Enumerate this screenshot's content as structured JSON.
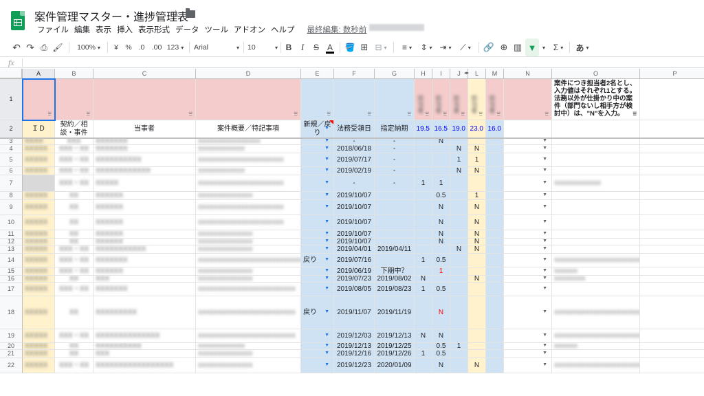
{
  "app": {
    "title": "案件管理マスター・進捗管理表",
    "last_edit": "最終編集: 数秒前",
    "menu": [
      "ファイル",
      "編集",
      "表示",
      "挿入",
      "表示形式",
      "データ",
      "ツール",
      "アドオン",
      "ヘルプ"
    ]
  },
  "toolbar": {
    "zoom": "100%",
    "currency": "¥",
    "percent": "%",
    "dec_less": ".0",
    "dec_more": ".00",
    "format_more": "123",
    "font": "Arial",
    "font_size": "10",
    "bold": "B",
    "italic": "I",
    "strike": "S",
    "text_color": "A",
    "sigma": "Σ",
    "input_tool": "あ"
  },
  "formula_bar": {
    "fx": "fx",
    "value": ""
  },
  "columns": [
    {
      "key": "A",
      "label": "A"
    },
    {
      "key": "B",
      "label": "B"
    },
    {
      "key": "C",
      "label": "C"
    },
    {
      "key": "D",
      "label": "D"
    },
    {
      "key": "E",
      "label": "E"
    },
    {
      "key": "F",
      "label": "F"
    },
    {
      "key": "G",
      "label": "G"
    },
    {
      "key": "H",
      "label": "H"
    },
    {
      "key": "I",
      "label": "I"
    },
    {
      "key": "J",
      "label": "J"
    },
    {
      "key": "L",
      "label": "L"
    },
    {
      "key": "M",
      "label": "M"
    },
    {
      "key": "N",
      "label": "N"
    },
    {
      "key": "O",
      "label": "O"
    },
    {
      "key": "P",
      "label": "P"
    }
  ],
  "header": {
    "row1_note": "案件につき担当者2名とし、入力値はそれぞれ1とする。法務以外が仕掛かり中の案件（部門ないし相手方が検討中）は、\"N\"を入力。",
    "row2": {
      "A": "ＩＤ",
      "B": "契約／相談・事件",
      "C": "当事者",
      "D": "案件概要／特記事項",
      "E": "新規／戻り",
      "F": "法務受領日",
      "G": "指定納期",
      "H": "19.5",
      "I": "16.5",
      "J": "19.0",
      "L": "23.0",
      "M": "16.0"
    }
  },
  "rows": [
    {
      "n": "3",
      "A": "XXXX",
      "B": "XXX",
      "C": "XXXXXXX",
      "D": "XXXXXXXXXXXXXXXX",
      "E": "",
      "F": "-",
      "G": "-",
      "H": "",
      "I": "N",
      "J": "",
      "L": "",
      "M": "",
      "O": ""
    },
    {
      "n": "4",
      "A": "XXXXX",
      "B": "XXX・XX",
      "C": "XXXXXXX",
      "D": "XXXXXXXXXXXX",
      "E": "",
      "F": "2018/06/18",
      "G": "-",
      "H": "",
      "I": "",
      "J": "N",
      "L": "N",
      "M": "",
      "O": ""
    },
    {
      "n": "5",
      "A": "XXXXX",
      "B": "XXX・XX",
      "C": "XXXXXXXXXX",
      "D": "XXXXXXXXXXXXXXXXXXXXXX",
      "E": "",
      "F": "2019/07/17",
      "G": "-",
      "H": "",
      "I": "",
      "J": "1",
      "L": "1",
      "M": "",
      "O": ""
    },
    {
      "n": "6",
      "A": "XXXXX",
      "B": "XXX・XX",
      "C": "XXXXXXXXXXXX",
      "D": "XXXXXXXXXXXX",
      "E": "",
      "F": "2019/02/19",
      "G": "-",
      "H": "",
      "I": "",
      "J": "N",
      "L": "N",
      "M": "",
      "O": ""
    },
    {
      "n": "7",
      "A": "",
      "B": "XXX・XX",
      "C": "XXXXX",
      "D": "XXXXXXXXXXXXXXXXXXXXXX",
      "E": "",
      "F": "-",
      "G": "-",
      "H": "1",
      "I": "1",
      "J": "",
      "L": "",
      "M": "",
      "O": "XXXXXXXXXXXX"
    },
    {
      "n": "8",
      "A": "XXXXX",
      "B": "XX",
      "C": "XXXXXX",
      "D": "XXXXXXXXXXXXXX",
      "E": "",
      "F": "2019/10/07",
      "G": "",
      "H": "",
      "I": "0.5",
      "J": "",
      "L": "1",
      "M": "",
      "O": ""
    },
    {
      "n": "9",
      "A": "XXXXX",
      "B": "XX",
      "C": "XXXXXX",
      "D": "XXXXXXXXXXXXXXXXXXXXXX",
      "E": "",
      "F": "2019/10/07",
      "G": "",
      "H": "",
      "I": "N",
      "J": "",
      "L": "N",
      "M": "",
      "O": ""
    },
    {
      "n": "10",
      "A": "XXXXX",
      "B": "XX",
      "C": "XXXXXX",
      "D": "XXXXXXXXXXXXXXXXXXXXXX",
      "E": "",
      "F": "2019/10/07",
      "G": "",
      "H": "",
      "I": "N",
      "J": "",
      "L": "N",
      "M": "",
      "O": ""
    },
    {
      "n": "11",
      "A": "XXXXX",
      "B": "XX",
      "C": "XXXXXX",
      "D": "XXXXXXXXXXXXXX",
      "E": "",
      "F": "2019/10/07",
      "G": "",
      "H": "",
      "I": "N",
      "J": "",
      "L": "N",
      "M": "",
      "O": ""
    },
    {
      "n": "12",
      "A": "XXXXX",
      "B": "XX",
      "C": "XXXXXX",
      "D": "XXXXXXXXXXXXXX",
      "E": "",
      "F": "2019/10/07",
      "G": "",
      "H": "",
      "I": "N",
      "J": "",
      "L": "N",
      "M": "",
      "O": ""
    },
    {
      "n": "13",
      "A": "XXXXX",
      "B": "XXX・XX",
      "C": "XXXXXXXXXXX",
      "D": "XXXXXXXXXXXXXX",
      "E": "",
      "F": "2019/04/01",
      "G": "2019/04/11",
      "H": "",
      "I": "",
      "J": "N",
      "L": "N",
      "M": "",
      "O": ""
    },
    {
      "n": "14",
      "A": "XXXXX",
      "B": "XXX・XX",
      "C": "XXXXXXX",
      "D": "XXXXXXXXXXXXXXXXXXXXXXXXXXXXXX",
      "E": "戻り",
      "F": "2019/07/16",
      "G": "",
      "H": "1",
      "I": "0.5",
      "J": "",
      "L": "",
      "M": "",
      "O": "XXXXXXXXXXXXXXXXXXXXXXXX"
    },
    {
      "n": "15",
      "A": "XXXXX",
      "B": "XXX・XX",
      "C": "XXXXXX",
      "D": "XXXXXXXXXXXXXX",
      "E": "",
      "F": "2019/06/19",
      "G": "下期中？",
      "H": "",
      "I": "1",
      "J": "",
      "L": "",
      "M": "",
      "O": "XXXXXX"
    },
    {
      "n": "16",
      "A": "XXXXX",
      "B": "XX",
      "C": "XXX",
      "D": "XXXXXXXXXXXXXX",
      "E": "",
      "F": "2019/07/23",
      "G": "2019/08/02",
      "H": "N",
      "I": "",
      "J": "",
      "L": "N",
      "M": "",
      "O": "XXXXXXXX"
    },
    {
      "n": "17",
      "A": "XXXXX",
      "B": "XXX・XX",
      "C": "XXXXXXX",
      "D": "XXXXXXXXXXXXXXXXXXXXXXXXX",
      "E": "",
      "F": "2019/08/05",
      "G": "2019/08/23",
      "H": "1",
      "I": "0.5",
      "J": "",
      "L": "",
      "M": "",
      "O": ""
    },
    {
      "n": "18",
      "A": "XXXXX",
      "B": "XX",
      "C": "XXXXXXXXX",
      "D": "XXXXXXXXXXXXXXXXXXXXXXXXX",
      "E": "戻り",
      "F": "2019/11/07",
      "G": "2019/11/19",
      "H": "",
      "I": "N",
      "J": "",
      "L": "",
      "M": "",
      "O": "XXXXXXXXXXXXXXXXXXXXXXXXXXXXXXXXXXXXXXXXXXXXXXXXXXXX"
    },
    {
      "n": "19",
      "A": "XXXXX",
      "B": "XXX・XX",
      "C": "XXXXXXXXXXXXXX",
      "D": "XXXXXXXXXXXXXXXXXXXXXXXXX",
      "E": "",
      "F": "2019/12/03",
      "G": "2019/12/13",
      "H": "N",
      "I": "N",
      "J": "",
      "L": "",
      "M": "",
      "O": "XXXXXXXXXXXXXXXXXXXXXXXXXXXXXXXXXXX"
    },
    {
      "n": "20",
      "A": "XXXXX",
      "B": "XX",
      "C": "XXXXXXXXXX",
      "D": "XXXXXXXXXXXX",
      "E": "",
      "F": "2019/12/13",
      "G": "2019/12/25",
      "H": "",
      "I": "0.5",
      "J": "1",
      "L": "",
      "M": "",
      "O": "XXXXXX"
    },
    {
      "n": "21",
      "A": "XXXXX",
      "B": "XX",
      "C": "XXX",
      "D": "XXXXXXXXXXXXXX",
      "E": "",
      "F": "2019/12/16",
      "G": "2019/12/26",
      "H": "1",
      "I": "0.5",
      "J": "",
      "L": "",
      "M": "",
      "O": ""
    },
    {
      "n": "22",
      "A": "XXXXX",
      "B": "XXX・XX",
      "C": "XXXXXXXXXXXXXXXXX",
      "D": "XXXXXXXXXXXXXX",
      "E": "",
      "F": "2019/12/23",
      "G": "2020/01/09",
      "H": "",
      "I": "N",
      "J": "",
      "L": "N",
      "M": "",
      "O": "XXXXXXXXXXXXXXXXXXXXXXXXXX"
    }
  ]
}
